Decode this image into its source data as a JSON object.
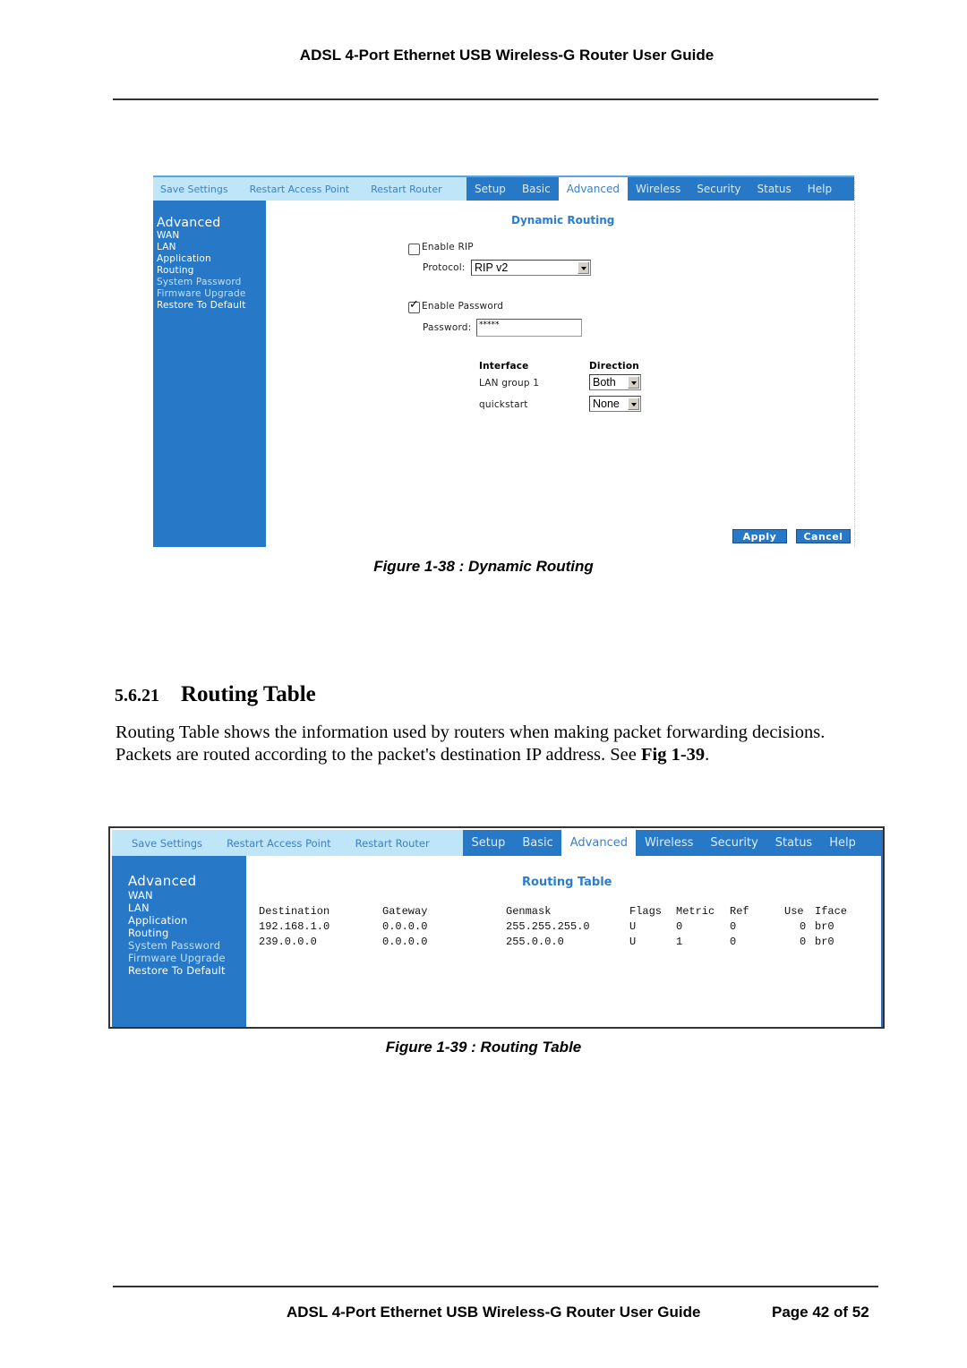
{
  "header": {
    "title": "ADSL 4-Port Ethernet USB Wireless-G Router User Guide"
  },
  "footer": {
    "title": "ADSL 4-Port Ethernet USB Wireless-G Router User Guide",
    "page": "Page 42 of 52"
  },
  "router_ui": {
    "utility_links": [
      "Save Settings",
      "Restart Access Point",
      "Restart Router"
    ],
    "tabs": [
      "Setup",
      "Basic",
      "Advanced",
      "Wireless",
      "Security",
      "Status",
      "Help"
    ],
    "active_tab": "Advanced",
    "sidebar": {
      "heading": "Advanced",
      "items": [
        "WAN",
        "LAN",
        "Application",
        "Routing",
        "System Password",
        "Firmware Upgrade",
        "Restore To Default"
      ]
    },
    "colors": {
      "primary_blue": "#2778c7",
      "light_blue": "#bfe6f8",
      "title_blue": "#2a7dd0"
    }
  },
  "figure38": {
    "title": "Dynamic Routing",
    "enable_rip": {
      "label": "Enable RIP",
      "checked": false
    },
    "protocol": {
      "label": "Protocol:",
      "value": "RIP v2"
    },
    "enable_password": {
      "label": "Enable Password",
      "checked": true
    },
    "password": {
      "label": "Password:",
      "value": "*****"
    },
    "interface_header": "Interface",
    "direction_header": "Direction",
    "interfaces": [
      {
        "name": "LAN group 1",
        "direction": "Both"
      },
      {
        "name": "quickstart",
        "direction": "None"
      }
    ],
    "apply_label": "Apply",
    "cancel_label": "Cancel",
    "caption": "Figure 1-38 : Dynamic Routing"
  },
  "section": {
    "number": "5.6.21",
    "title": "Routing Table",
    "paragraph_line1": "Routing Table shows the information used by routers when making packet forwarding decisions.",
    "paragraph_line2_pre": "Packets are routed according to the packet's destination IP address.  See ",
    "paragraph_line2_ref": "Fig 1-39",
    "paragraph_line2_post": "."
  },
  "figure39": {
    "title": "Routing Table",
    "columns": [
      "Destination",
      "Gateway",
      "Genmask",
      "Flags",
      "Metric",
      "Ref",
      "Use",
      "Iface"
    ],
    "rows": [
      [
        "192.168.1.0",
        "0.0.0.0",
        "255.255.255.0",
        "U",
        "0",
        "0",
        "0",
        "br0"
      ],
      [
        "239.0.0.0",
        "0.0.0.0",
        "255.0.0.0",
        "U",
        "1",
        "0",
        "0",
        "br0"
      ]
    ],
    "caption": "Figure 1-39 : Routing Table"
  }
}
